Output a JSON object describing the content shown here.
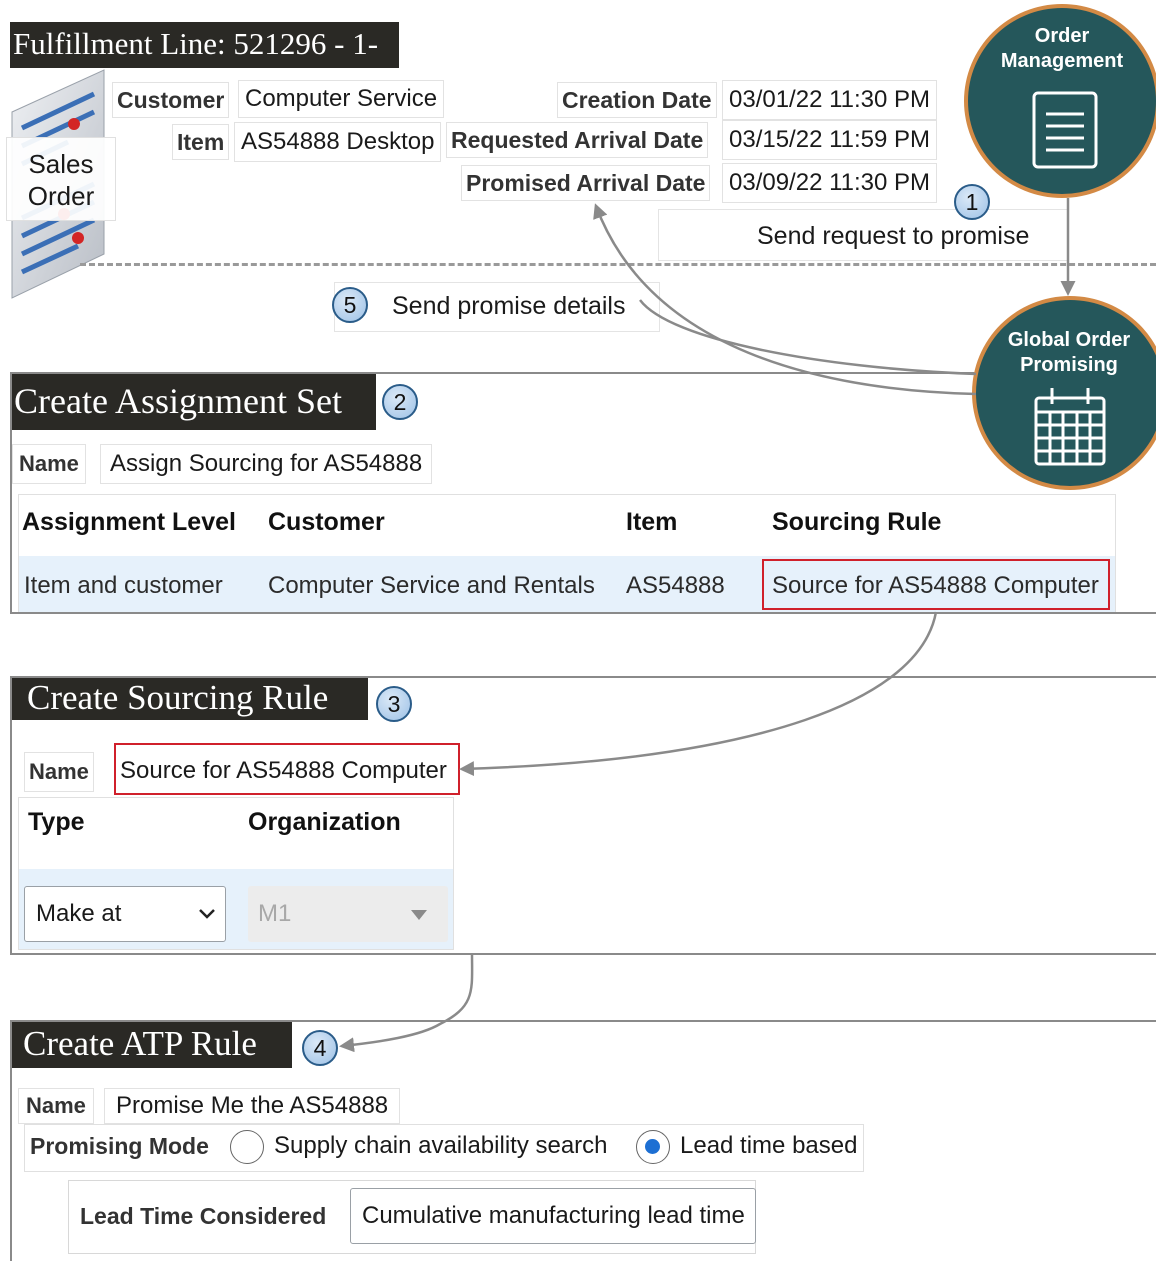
{
  "fulfillment": {
    "title": "Fulfillment Line: 521296 - 1-",
    "sales_order_label": "Sales Order",
    "customer_label": "Customer",
    "customer_value": "Computer Service",
    "item_label": "Item",
    "item_value": "AS54888 Desktop",
    "creation_date_label": "Creation Date",
    "creation_date_value": "03/01/22 11:30 PM",
    "requested_label": "Requested Arrival Date",
    "requested_value": "03/15/22 11:59 PM",
    "promised_label": "Promised Arrival Date",
    "promised_value": "03/09/22 11:30 PM"
  },
  "flow": {
    "step1_number": "1",
    "step1_label": "Send request to promise",
    "step5_number": "5",
    "step5_label": "Send promise details",
    "order_management": "Order Management",
    "global_order_promising": "Global Order Promising",
    "order_icon": "document-icon",
    "promising_icon": "calendar-icon"
  },
  "assignment_set": {
    "title": "Create Assignment Set",
    "step_number": "2",
    "name_label": "Name",
    "name_value": "Assign Sourcing for AS54888",
    "columns": [
      "Assignment Level",
      "Customer",
      "Item",
      "Sourcing Rule"
    ],
    "row": [
      "Item and customer",
      "Computer Service and Rentals",
      "AS54888",
      "Source for AS54888 Computer"
    ]
  },
  "sourcing_rule": {
    "title": "Create Sourcing Rule",
    "step_number": "3",
    "name_label": "Name",
    "name_value": "Source for AS54888 Computer",
    "col_type": "Type",
    "col_org": "Organization",
    "type_value": "Make at",
    "org_value": "M1"
  },
  "atp_rule": {
    "title": "Create ATP Rule",
    "step_number": "4",
    "name_label": "Name",
    "name_value": "Promise Me the AS54888",
    "promising_mode_label": "Promising Mode",
    "option_supply": "Supply chain availability search",
    "option_lead": "Lead time based",
    "selected_option": "Lead time based",
    "lead_time_label": "Lead Time Considered",
    "lead_time_value": "Cumulative manufacturing lead time"
  },
  "colors": {
    "node_fill": "#25575b",
    "node_border": "#d38a45",
    "highlight": "#d0202b",
    "title_bar": "#2a2925",
    "row_highlight": "#e6f1fb",
    "badge_border": "#2a5c89"
  }
}
